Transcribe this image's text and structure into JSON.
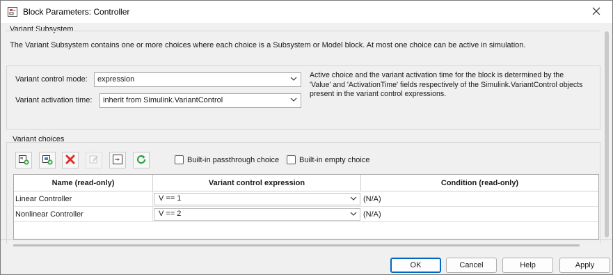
{
  "window": {
    "title": "Block Parameters: Controller",
    "close_icon": "close-icon"
  },
  "variant_subsystem": {
    "heading": "Variant Subsystem",
    "description": "The Variant Subsystem contains one or more choices where each choice is a Subsystem or Model block. At most one choice can be active in simulation."
  },
  "controls": {
    "mode_label": "Variant control mode:",
    "mode_value": "expression",
    "activation_label": "Variant activation time:",
    "activation_value": "inherit from Simulink.VariantControl",
    "info_line1": "Active choice and the variant activation time for the block is determined by the",
    "info_line2": "'Value' and 'ActivationTime' fields respectively of the Simulink.VariantControl objects",
    "info_line3": "present in the variant control expressions."
  },
  "variant_choices": {
    "heading": "Variant choices",
    "toolbar_icons": [
      "add-subsystem-choice-icon",
      "add-model-choice-icon",
      "delete-choice-icon",
      "edit-choice-icon",
      "open-block-icon",
      "refresh-icon"
    ],
    "passthrough_label": "Built-in passthrough choice",
    "empty_label": "Built-in empty choice"
  },
  "table": {
    "headers": [
      "Name (read-only)",
      "Variant control expression",
      "Condition (read-only)"
    ],
    "rows": [
      {
        "name": "Linear Controller",
        "expression": "V == 1",
        "condition": "(N/A)"
      },
      {
        "name": "Nonlinear Controller",
        "expression": "V == 2",
        "condition": "(N/A)"
      }
    ]
  },
  "buttons": {
    "ok": "OK",
    "cancel": "Cancel",
    "help": "Help",
    "apply": "Apply"
  },
  "colors": {
    "accent": "#0067c0",
    "delete_red": "#d9312b",
    "refresh_green": "#1e9a3c"
  }
}
